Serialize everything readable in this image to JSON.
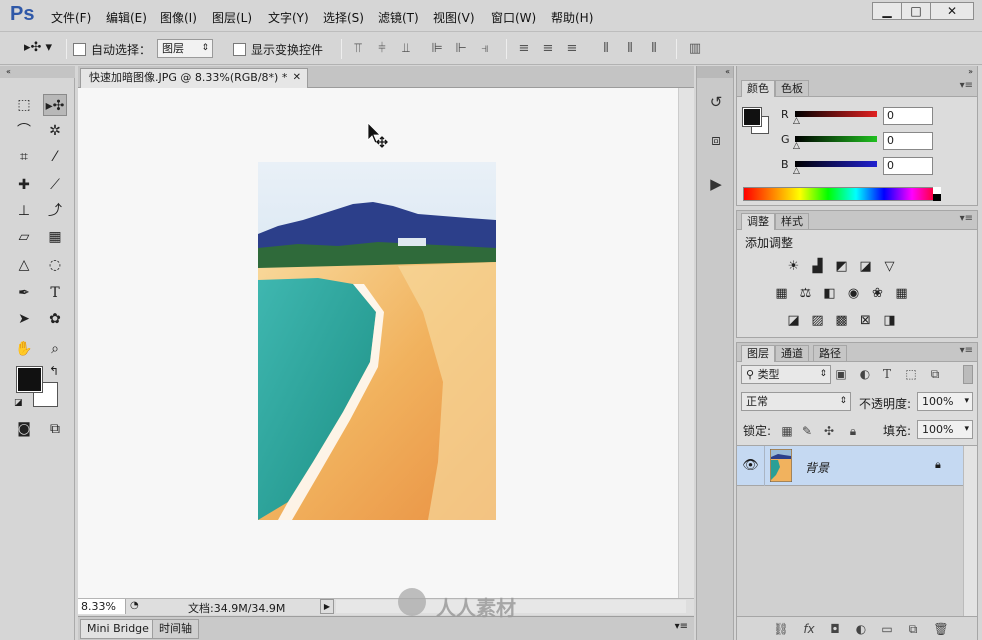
{
  "app": {
    "logo": "Ps"
  },
  "menu": [
    "文件(F)",
    "编辑(E)",
    "图像(I)",
    "图层(L)",
    "文字(Y)",
    "选择(S)",
    "滤镜(T)",
    "视图(V)",
    "窗口(W)",
    "帮助(H)"
  ],
  "window_controls": {
    "minimize": "▁",
    "maximize": "□",
    "close": "✕"
  },
  "options": {
    "auto_select_label": "自动选择：",
    "auto_select_target": "图层",
    "show_transform_label": "显示变换控件"
  },
  "document": {
    "tab_title": "快速加暗图像.JPG @ 8.33%(RGB/8*) *",
    "tab_close": "✕",
    "zoom": "8.33%",
    "doc_info": "文档:34.9M/34.9M"
  },
  "bottom_tabs": [
    "Mini Bridge",
    "时间轴"
  ],
  "watermark": "人人素材",
  "color_panel": {
    "tabs": [
      "颜色",
      "色板"
    ],
    "labels": [
      "R",
      "G",
      "B"
    ],
    "values": [
      "0",
      "0",
      "0"
    ],
    "colors": {
      "r": "#e02020",
      "g": "#20c020",
      "b": "#2020d0"
    }
  },
  "adjust_panel": {
    "tabs": [
      "调整",
      "样式"
    ],
    "title": "添加调整"
  },
  "layers_panel": {
    "tabs": [
      "图层",
      "通道",
      "路径"
    ],
    "filter_label": "类型",
    "blend_mode": "正常",
    "opacity_label": "不透明度:",
    "opacity_value": "100%",
    "lock_label": "锁定:",
    "fill_label": "填充:",
    "fill_value": "100%",
    "layers": [
      {
        "name": "背景",
        "visible": true,
        "locked": true
      }
    ]
  },
  "colors": {
    "accent_logo": "#2f58a8",
    "selected_layer": "#c5d9f2"
  }
}
